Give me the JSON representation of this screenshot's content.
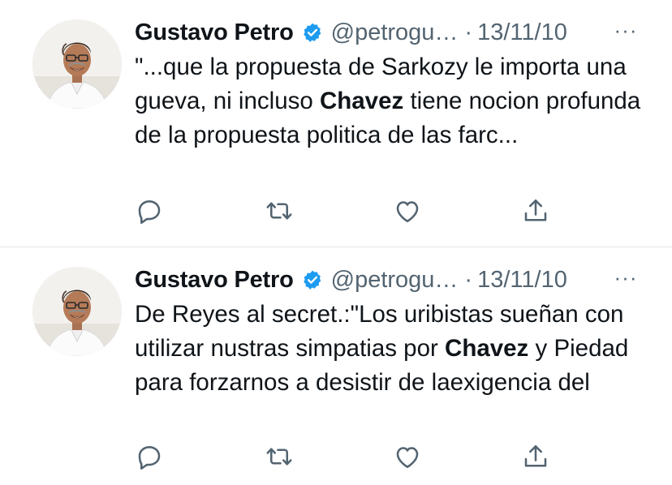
{
  "tweets": [
    {
      "author": {
        "name": "Gustavo Petro",
        "handle": "@petrogu…",
        "verified_icon": "verified-badge-icon",
        "avatar": "profile-photo"
      },
      "separator": "·",
      "date": "13/11/10",
      "more_icon": "ellipsis-icon",
      "more_label": "···",
      "text": {
        "before": "\"...que la propuesta de Sarkozy le importa una gueva, ni incluso ",
        "bold": "Chavez",
        "after": " tiene nocion profunda de la propuesta politica de las farc..."
      },
      "actions": [
        "reply-icon",
        "retweet-icon",
        "like-icon",
        "share-icon"
      ]
    },
    {
      "author": {
        "name": "Gustavo Petro",
        "handle": "@petrogu…",
        "verified_icon": "verified-badge-icon",
        "avatar": "profile-photo"
      },
      "separator": "·",
      "date": "13/11/10",
      "more_icon": "ellipsis-icon",
      "more_label": "···",
      "text": {
        "before": "De Reyes al secret.:\"Los uribistas sueñan con utilizar nustras simpatias por ",
        "bold": "Chavez",
        "after": " y Piedad para forzarnos a desistir de laexigencia del"
      },
      "actions": [
        "reply-icon",
        "retweet-icon",
        "like-icon",
        "share-icon"
      ]
    }
  ],
  "colors": {
    "text": "#0f1419",
    "secondary": "#536471",
    "verified": "#1d9bf0",
    "divider": "#e4e7ea"
  }
}
